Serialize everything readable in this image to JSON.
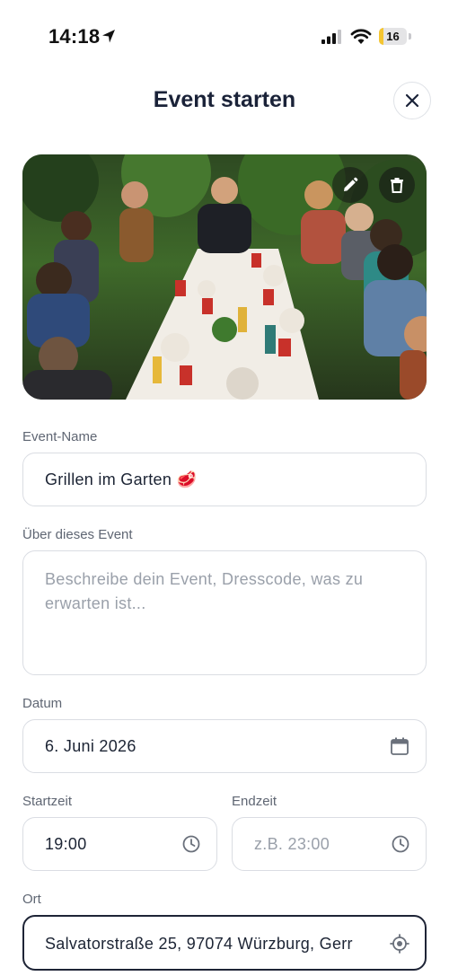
{
  "status_bar": {
    "time": "14:18",
    "battery_level": "16",
    "battery_fraction": 0.16
  },
  "header": {
    "title": "Event starten",
    "close_icon": "close-icon"
  },
  "image": {
    "edit_icon": "pencil-icon",
    "delete_icon": "trash-icon"
  },
  "form": {
    "event_name": {
      "label": "Event-Name",
      "value": "Grillen im Garten 🥩"
    },
    "description": {
      "label": "Über dieses Event",
      "placeholder": "Beschreibe dein Event, Dresscode, was zu erwarten ist..."
    },
    "date": {
      "label": "Datum",
      "value": "6. Juni 2026",
      "icon": "calendar-icon"
    },
    "start_time": {
      "label": "Startzeit",
      "value": "19:00",
      "icon": "clock-icon"
    },
    "end_time": {
      "label": "Endzeit",
      "placeholder": "z.B. 23:00",
      "icon": "clock-icon"
    },
    "location": {
      "label": "Ort",
      "value": "Salvatorstraße 25, 97074 Würzburg, Gerr",
      "icon": "locate-icon"
    }
  },
  "colors": {
    "text_primary": "#1c2434",
    "label": "#5f6673",
    "placeholder": "#9aa0aa",
    "border": "#dadde3",
    "focused_border": "#1e2436",
    "battery": "#f4c531"
  }
}
